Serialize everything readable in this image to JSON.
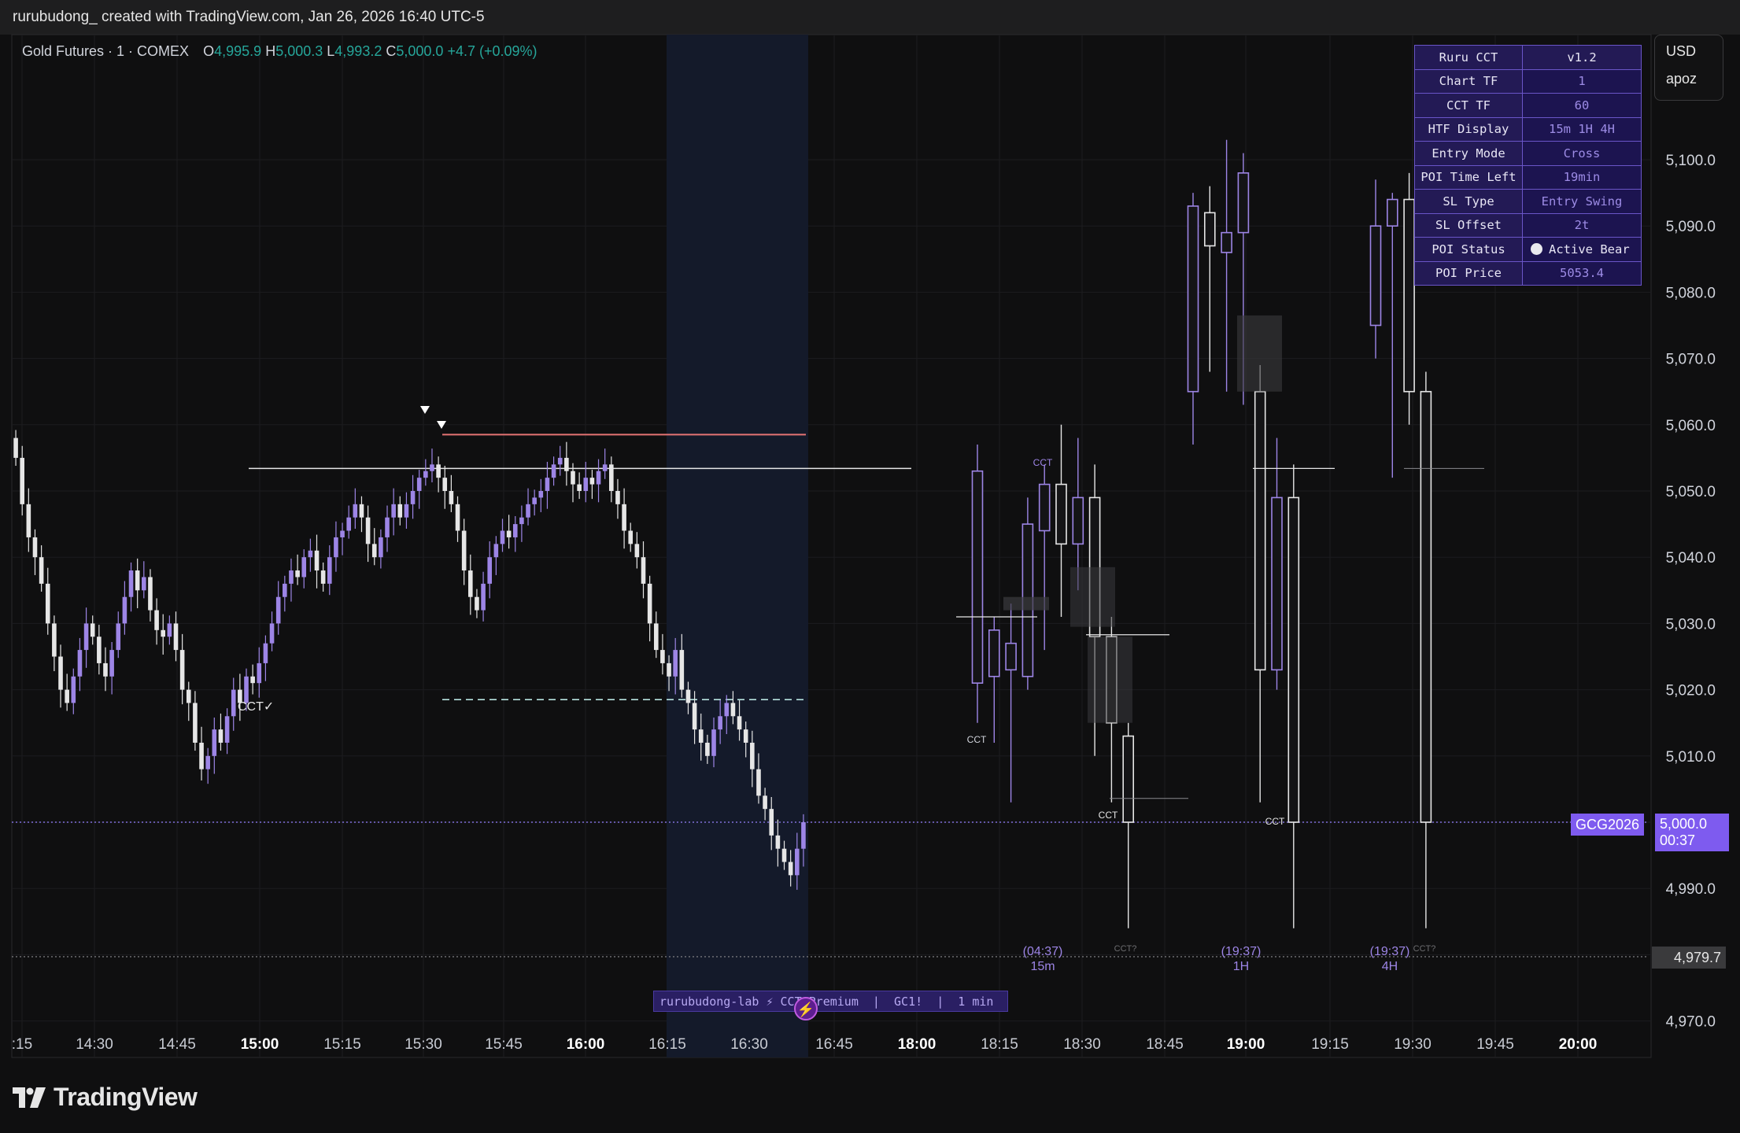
{
  "header": {
    "title": "rurubudong_ created with TradingView.com, Jan 26, 2026 16:40 UTC-5"
  },
  "symbol": {
    "name": "Gold Futures · 1 · COMEX",
    "o_label": "O",
    "o_value": "4,995.9",
    "h_label": "H",
    "h_value": "5,000.3",
    "l_label": "L",
    "l_value": "4,993.2",
    "c_label": "C",
    "c_value": "5,000.0",
    "change": "+4.7 (+0.09%)"
  },
  "currency": {
    "unit": "USD",
    "user": "apoz"
  },
  "indicator_table": {
    "title": "Ruru CCT",
    "version": "v1.2",
    "rows": [
      {
        "key": "Chart TF",
        "value": "1"
      },
      {
        "key": "CCT TF",
        "value": "60"
      },
      {
        "key": "HTF Display",
        "value": "15m 1H 4H"
      },
      {
        "key": "Entry Mode",
        "value": "Cross"
      },
      {
        "key": "POI Time Left",
        "value": "19min"
      },
      {
        "key": "SL Type",
        "value": "Entry Swing"
      },
      {
        "key": "SL Offset",
        "value": "2t"
      },
      {
        "key": "POI Status",
        "value": "Active Bear"
      },
      {
        "key": "POI Price",
        "value": "5053.4"
      }
    ]
  },
  "price_tags": {
    "symbol_tag": "GCG2026",
    "last_price": "5,000.0",
    "countdown": "00:37",
    "low_level": "4,979.7"
  },
  "banner": "rurubudong-lab ⚡ CCT Premium  |  GC1!  |  1 min",
  "footer": {
    "brand": "TradingView"
  },
  "colors": {
    "background": "#0f0f10",
    "bull_candle": "#9d85e6",
    "bear_candle": "#e6e6e6",
    "accent_purple": "#7e5bef",
    "positive": "#26a69a",
    "session_highlight": "#141a2a"
  },
  "chart_data": {
    "type": "candlestick",
    "y_ticks": [
      "5,100.0",
      "5,090.0",
      "5,080.0",
      "5,070.0",
      "5,060.0",
      "5,050.0",
      "5,040.0",
      "5,030.0",
      "5,020.0",
      "5,010.0",
      "5,000.0",
      "4,990.0",
      "4,980.0",
      "4,970.0"
    ],
    "x_ticks": [
      {
        "label": ":15",
        "bold": false
      },
      {
        "label": "14:30",
        "bold": false
      },
      {
        "label": "14:45",
        "bold": false
      },
      {
        "label": "15:00",
        "bold": true
      },
      {
        "label": "15:15",
        "bold": false
      },
      {
        "label": "15:30",
        "bold": false
      },
      {
        "label": "15:45",
        "bold": false
      },
      {
        "label": "16:00",
        "bold": true
      },
      {
        "label": "16:15",
        "bold": false
      },
      {
        "label": "16:30",
        "bold": false
      },
      {
        "label": "16:45",
        "bold": false
      },
      {
        "label": "18:00",
        "bold": true
      },
      {
        "label": "18:15",
        "bold": false
      },
      {
        "label": "18:30",
        "bold": false
      },
      {
        "label": "18:45",
        "bold": false
      },
      {
        "label": "19:00",
        "bold": true
      },
      {
        "label": "19:15",
        "bold": false
      },
      {
        "label": "19:30",
        "bold": false
      },
      {
        "label": "19:45",
        "bold": false
      },
      {
        "label": "20:00",
        "bold": true
      }
    ],
    "ylim": [
      4968.0,
      5110.0
    ],
    "levels": {
      "last_price": 5000.0,
      "low_level": 4979.7,
      "poi_price": 5053.4,
      "stop_line": 5058.5,
      "target_dashed": 5018.5
    },
    "one_minute_closes": [
      5055,
      5048,
      5043,
      5040,
      5036,
      5030,
      5025,
      5020,
      5018,
      5022,
      5026,
      5030,
      5028,
      5024,
      5022,
      5026,
      5030,
      5034,
      5038,
      5035,
      5037,
      5032,
      5029,
      5028,
      5030,
      5026,
      5020,
      5018,
      5012,
      5008,
      5010,
      5014,
      5012,
      5016,
      5020,
      5018,
      5022,
      5021,
      5024,
      5027,
      5030,
      5034,
      5036,
      5038,
      5037,
      5040,
      5041,
      5038,
      5036,
      5040,
      5043,
      5044,
      5046,
      5048,
      5046,
      5042,
      5040,
      5043,
      5046,
      5048,
      5046,
      5048,
      5050,
      5052,
      5053,
      5054,
      5052,
      5050,
      5048,
      5044,
      5038,
      5034,
      5032,
      5036,
      5040,
      5042,
      5044,
      5043,
      5045,
      5046,
      5048,
      5049,
      5050,
      5052,
      5054,
      5055,
      5053,
      5051,
      5050,
      5052,
      5051,
      5053,
      5054,
      5050,
      5048,
      5044,
      5042,
      5040,
      5036,
      5030,
      5026,
      5024,
      5022,
      5026,
      5020,
      5018,
      5014,
      5012,
      5010,
      5014,
      5016,
      5018,
      5016,
      5014,
      5012,
      5008,
      5004,
      5002,
      4998,
      4996,
      4994,
      4992,
      4996,
      5000
    ],
    "htf_candles": [
      {
        "tf": "15m",
        "bars": [
          {
            "o": 5021,
            "h": 5057,
            "l": 5015,
            "c": 5053
          },
          {
            "o": 5022,
            "h": 5031,
            "l": 5012,
            "c": 5029
          },
          {
            "o": 5023,
            "h": 5033,
            "l": 5003,
            "c": 5027
          },
          {
            "o": 5022,
            "h": 5049,
            "l": 5020,
            "c": 5045
          },
          {
            "o": 5044,
            "h": 5054,
            "l": 5026,
            "c": 5051
          },
          {
            "o": 5051,
            "h": 5060,
            "l": 5031,
            "c": 5042
          },
          {
            "o": 5042,
            "h": 5058,
            "l": 5035,
            "c": 5049
          },
          {
            "o": 5049,
            "h": 5054,
            "l": 5010,
            "c": 5028
          },
          {
            "o": 5028,
            "h": 5031,
            "l": 5003,
            "c": 5015
          },
          {
            "o": 5013,
            "h": 5015,
            "l": 4984,
            "c": 5000
          }
        ],
        "label_time": "(04:37)"
      },
      {
        "tf": "1H",
        "bars": [
          {
            "o": 5065,
            "h": 5095,
            "l": 5057,
            "c": 5093
          },
          {
            "o": 5092,
            "h": 5096,
            "l": 5068,
            "c": 5087
          },
          {
            "o": 5086,
            "h": 5103,
            "l": 5065,
            "c": 5089
          },
          {
            "o": 5089,
            "h": 5101,
            "l": 5063,
            "c": 5098
          },
          {
            "o": 5065,
            "h": 5069,
            "l": 5003,
            "c": 5023
          },
          {
            "o": 5023,
            "h": 5058,
            "l": 5020,
            "c": 5049
          },
          {
            "o": 5049,
            "h": 5054,
            "l": 4984,
            "c": 5000
          }
        ],
        "label_time": "(19:37)"
      },
      {
        "tf": "4H",
        "bars": [
          {
            "o": 5075,
            "h": 5097,
            "l": 5070,
            "c": 5090
          },
          {
            "o": 5090,
            "h": 5095,
            "l": 5052,
            "c": 5094
          },
          {
            "o": 5094,
            "h": 5098,
            "l": 5060,
            "c": 5065
          },
          {
            "o": 5065,
            "h": 5068,
            "l": 4984,
            "c": 5000
          }
        ],
        "label_time": "(19:37)"
      }
    ],
    "annotations": [
      "CCT✓",
      "CCT",
      "CCT",
      "CCT",
      "CCT",
      "CCT?",
      "CCT?",
      "15m",
      "1H",
      "4H"
    ]
  }
}
